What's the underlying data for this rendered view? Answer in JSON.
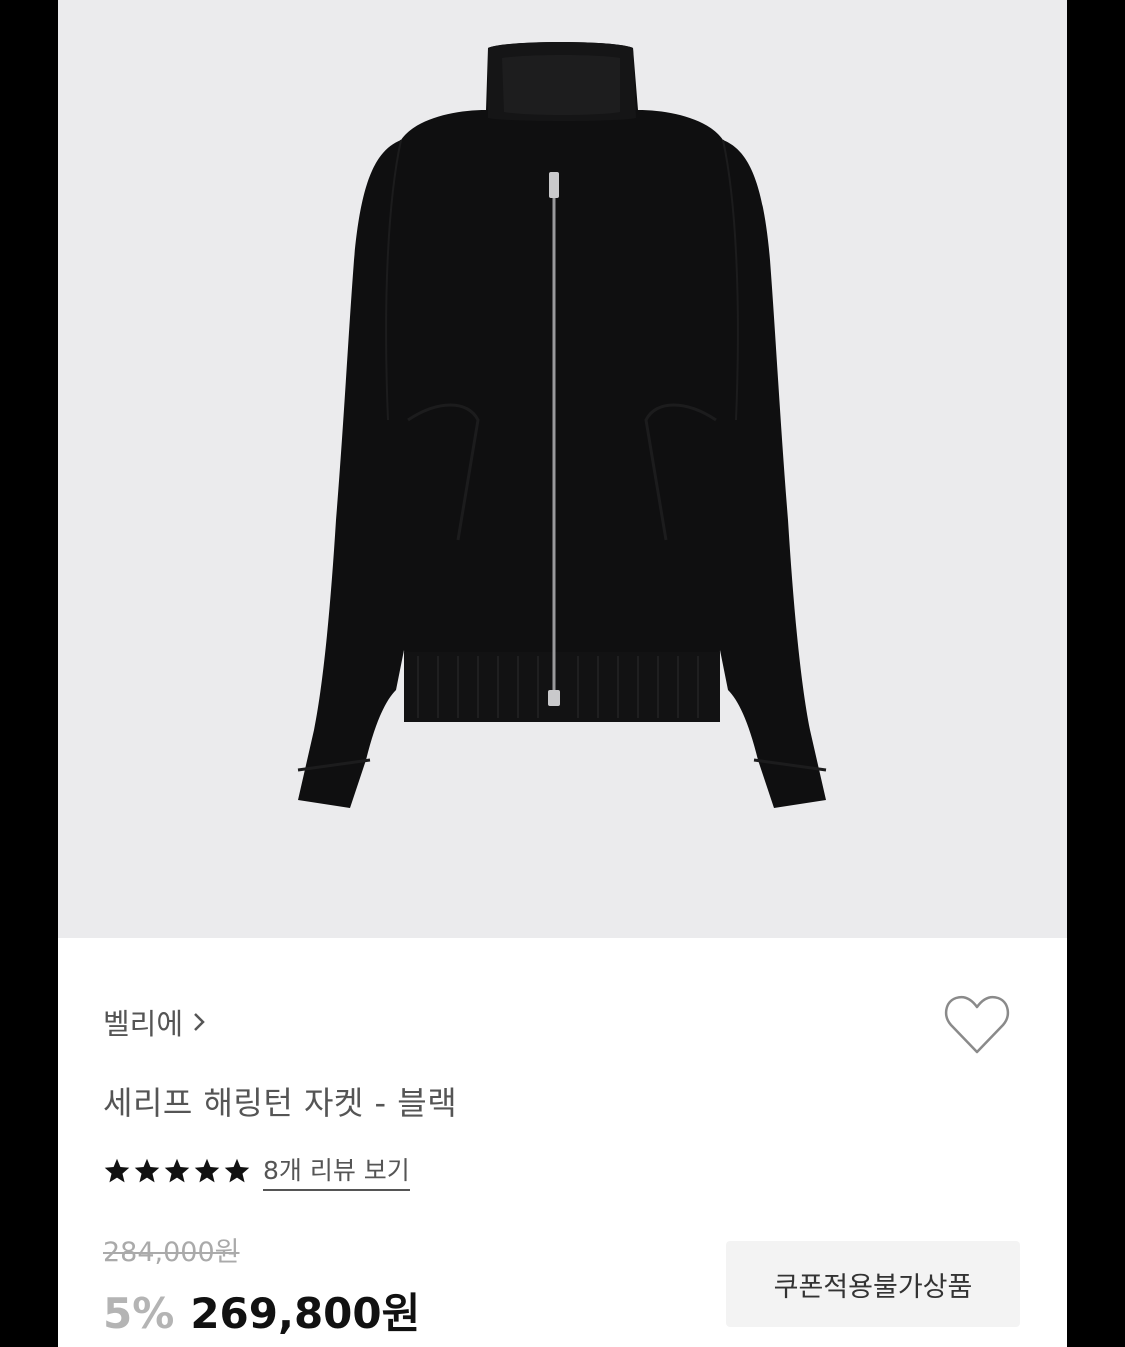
{
  "product": {
    "image_alt": "세리프 해링턴 자켓 - 블랙",
    "brand": "벨리에",
    "title": "세리프 해링턴 자켓 - 블랙",
    "rating": 5,
    "review_link": "8개 리뷰 보기",
    "original_price": "284,000원",
    "discount": "5%",
    "price": "269,800원",
    "coupon_badge": "쿠폰적용불가상품"
  },
  "icons": {
    "brand_chevron": "chevron-right-icon",
    "wishlist": "heart-outline-icon",
    "rating": "star-icon"
  },
  "colors": {
    "image_background": "#ebebed",
    "text_primary": "#111111",
    "text_secondary": "#555555",
    "discount": "#b4b4b4"
  }
}
